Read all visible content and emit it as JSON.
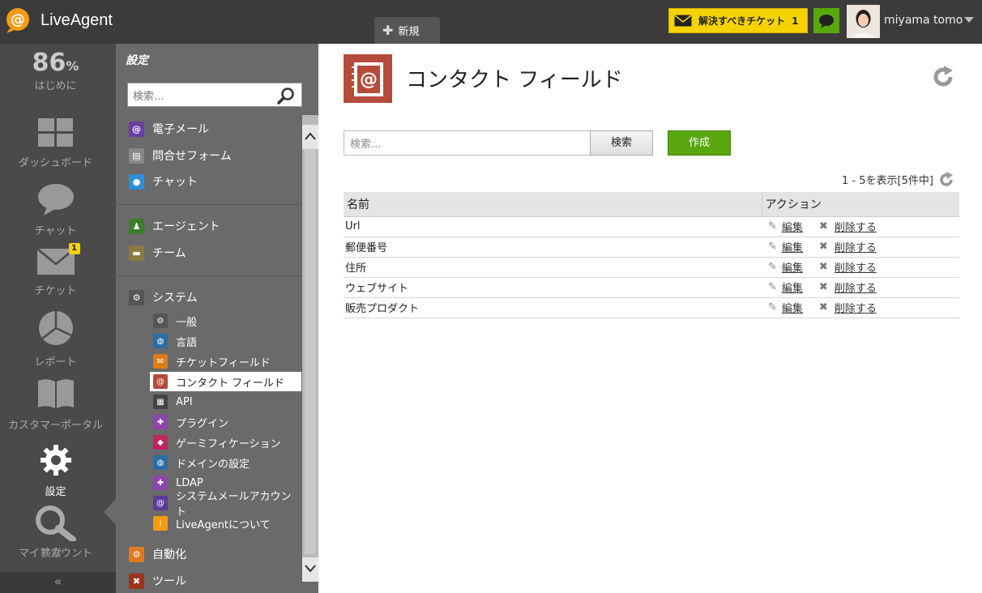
{
  "app": {
    "name": "LiveAgent"
  },
  "topbar": {
    "new_tab": "新規",
    "tickets_label": "解決すべきチケット",
    "tickets_count": "1",
    "username": "miyama tomo"
  },
  "iconbar": {
    "progress": "86",
    "progress_unit": "%",
    "items": [
      {
        "label": "はじめに"
      },
      {
        "label": "ダッシュボード"
      },
      {
        "label": "チャット"
      },
      {
        "label": "チケット",
        "badge": "1"
      },
      {
        "label": "レポート"
      },
      {
        "label": "カスタマーポータル"
      },
      {
        "label": "設定"
      },
      {
        "label": "マイアカウント"
      },
      {
        "overlay": "検索"
      }
    ]
  },
  "settings": {
    "title": "設定",
    "search_placeholder": "検索...",
    "groups": [
      {
        "label": "電子メール"
      },
      {
        "label": "問合せフォーム"
      },
      {
        "label": "チャット"
      },
      {
        "label": "エージェント"
      },
      {
        "label": "チーム"
      },
      {
        "label": "システム"
      }
    ],
    "system_items": [
      {
        "label": "一般"
      },
      {
        "label": "言語"
      },
      {
        "label": "チケットフィールド"
      },
      {
        "label": "コンタクト フィールド"
      },
      {
        "label": "API"
      },
      {
        "label": "プラグイン"
      },
      {
        "label": "ゲーミフィケーション"
      },
      {
        "label": "ドメインの設定"
      },
      {
        "label": "LDAP"
      },
      {
        "label": "システムメールアカウント"
      },
      {
        "label": "LiveAgentについて"
      }
    ],
    "bottom_items": [
      {
        "label": "自動化"
      },
      {
        "label": "ツール"
      }
    ]
  },
  "main": {
    "title": "コンタクト フィールド",
    "search_placeholder": "検索...",
    "search_button": "検索",
    "create_button": "作成",
    "pager": "1 - 5を表示[5件中]",
    "columns": [
      "名前",
      "アクション"
    ],
    "edit_label": "編集",
    "delete_label": "削除する",
    "rows": [
      {
        "name": "Url"
      },
      {
        "name": "郵便番号"
      },
      {
        "name": "住所"
      },
      {
        "name": "ウェブサイト"
      },
      {
        "name": "販売プロダクト"
      }
    ]
  },
  "colors": {
    "topbar": "#3b3b3b",
    "accent_green": "#5aa610",
    "ticket_yellow": "#f5d300",
    "brand_orange": "#f39c12"
  }
}
